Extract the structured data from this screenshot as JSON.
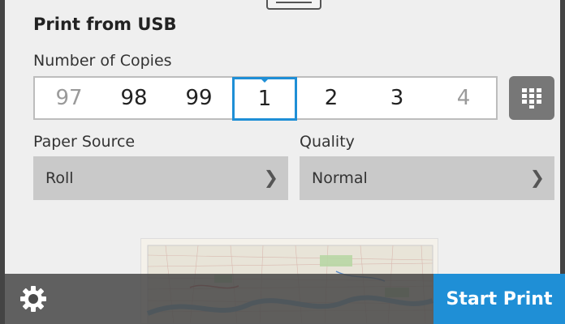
{
  "header": {
    "title": "Print from USB"
  },
  "copies": {
    "label": "Number of Copies",
    "values": [
      "97",
      "98",
      "99",
      "1",
      "2",
      "3",
      "4"
    ],
    "selected": "1"
  },
  "paper_source": {
    "label": "Paper Source",
    "value": "Roll"
  },
  "quality": {
    "label": "Quality",
    "value": "Normal"
  },
  "footer": {
    "start_label": "Start Print"
  },
  "icons": {
    "keypad": "keypad-icon",
    "settings": "gear-icon",
    "chevron": "chevron-right-icon"
  },
  "colors": {
    "accent": "#1f8fd6",
    "bar": "#464646",
    "select_bg": "#c9c9c9"
  }
}
